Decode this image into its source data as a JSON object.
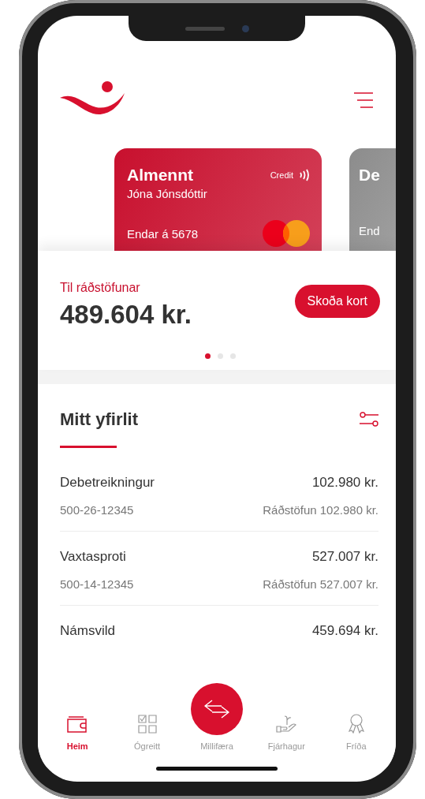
{
  "cards": [
    {
      "title": "Almennt",
      "holder": "Jóna Jónsdóttir",
      "type": "Credit",
      "ending": "Endar á 5678",
      "color": "#c8102e",
      "contactless": true,
      "mastercard": true
    },
    {
      "title": "De",
      "ending": "End",
      "color": "#8c8c8c"
    }
  ],
  "balance": {
    "label": "Til ráðstöfunar",
    "amount": "489.604 kr.",
    "button": "Skoða kort"
  },
  "pager": [
    {
      "selected": true
    },
    {
      "selected": false
    },
    {
      "selected": false
    }
  ],
  "overview": {
    "title": "Mitt yfirlit",
    "accounts": [
      {
        "name": "Debetreikningur",
        "amount": "102.980 kr.",
        "number": "500-26-12345",
        "available": "Ráðstöfun 102.980 kr."
      },
      {
        "name": "Vaxtasproti",
        "amount": "527.007 kr.",
        "number": "500-14-12345",
        "available": "Ráðstöfun 527.007 kr."
      },
      {
        "name": "Námsvild",
        "amount": "459.694 kr."
      }
    ]
  },
  "nav": [
    {
      "kind": "tab",
      "label": "Heim",
      "selected": true
    },
    {
      "kind": "tab",
      "label": "Ógreitt",
      "selected": false
    },
    {
      "kind": "action",
      "label": "Millifæra",
      "selected": false
    },
    {
      "kind": "tab",
      "label": "Fjárhagur",
      "selected": false
    },
    {
      "kind": "tab",
      "label": "Fríða",
      "selected": false
    }
  ]
}
